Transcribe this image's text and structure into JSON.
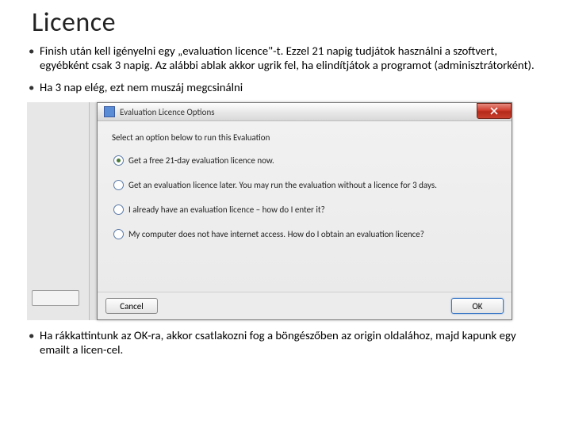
{
  "title": "Licence",
  "bullets": {
    "b1": "Finish után kell igényelni egy „evaluation licence\"-t. Ezzel 21 napig tudjátok használni a szoftvert, egyébként csak 3 napig. Az alábbi ablak akkor ugrik fel, ha elindítjátok a programot (adminisztrátorként).",
    "b2": "Ha 3 nap elég, ezt nem muszáj megcsinálni",
    "b3": "Ha rákkattintunk az OK-ra, akkor csatlakozni fog a böngészőben az origin oldalához, majd kapunk egy emailt a licen-cel."
  },
  "dialog": {
    "title": "Evaluation Licence Options",
    "prompt": "Select an option below to run this Evaluation",
    "options": {
      "o1": "Get a free 21-day evaluation licence now.",
      "o2": "Get an evaluation licence later. You may run the evaluation without a licence for 3 days.",
      "o3": "I already have an evaluation licence – how do I enter it?",
      "o4": "My computer does not have internet access. How do I obtain an evaluation licence?"
    },
    "cancel": "Cancel",
    "ok": "OK"
  }
}
